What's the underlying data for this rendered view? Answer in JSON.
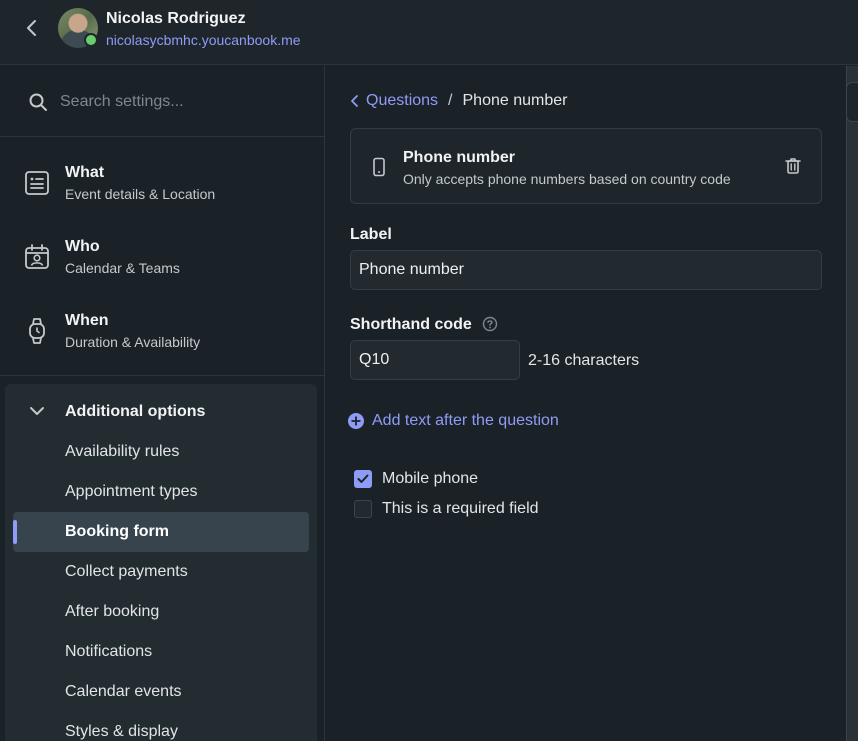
{
  "header": {
    "user_name": "Nicolas Rodriguez",
    "user_link": "nicolasycbmhc.youcanbook.me"
  },
  "sidebar": {
    "search_placeholder": "Search settings...",
    "sections": [
      {
        "title": "What",
        "subtitle": "Event details & Location",
        "icon": "form-icon"
      },
      {
        "title": "Who",
        "subtitle": "Calendar & Teams",
        "icon": "calendar-person-icon"
      },
      {
        "title": "When",
        "subtitle": "Duration & Availability",
        "icon": "watch-icon"
      }
    ],
    "additional": {
      "title": "Additional options",
      "items": [
        {
          "label": "Availability rules",
          "active": false
        },
        {
          "label": "Appointment types",
          "active": false
        },
        {
          "label": "Booking form",
          "active": true
        },
        {
          "label": "Collect payments",
          "active": false
        },
        {
          "label": "After booking",
          "active": false
        },
        {
          "label": "Notifications",
          "active": false
        },
        {
          "label": "Calendar events",
          "active": false
        },
        {
          "label": "Styles & display",
          "active": false
        }
      ]
    }
  },
  "main": {
    "breadcrumb": {
      "parent": "Questions",
      "separator": "/",
      "current": "Phone number"
    },
    "question_card": {
      "title": "Phone number",
      "description": "Only accepts phone numbers based on country code"
    },
    "label_field": {
      "label": "Label",
      "value": "Phone number"
    },
    "shorthand_field": {
      "label": "Shorthand code",
      "value": "Q10",
      "hint": "2-16 characters"
    },
    "add_text_link": "Add text after the question",
    "checkboxes": [
      {
        "label": "Mobile phone",
        "checked": true
      },
      {
        "label": "This is a required field",
        "checked": false
      }
    ]
  },
  "colors": {
    "accent": "#8e9cf7",
    "background": "#1b2227",
    "presence": "#69cf6a"
  }
}
